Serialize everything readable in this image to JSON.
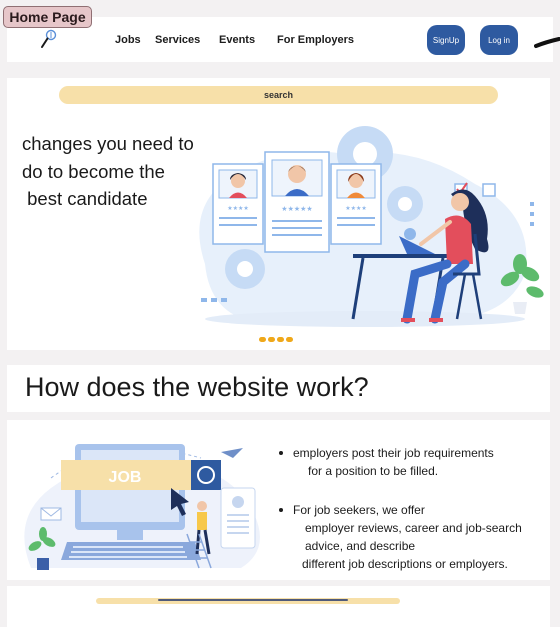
{
  "frame_label": "Home Page",
  "nav": {
    "links": [
      "Jobs",
      "Services",
      "Events",
      "For Employers"
    ],
    "signup_label": "SignUp",
    "login_label": "Log in"
  },
  "search": {
    "label": "search"
  },
  "hero": {
    "lines": [
      "changes you need to",
      "do to become the",
      " best candidate"
    ],
    "illustration_icon": "job-candidates-illustration",
    "carousel_dots": 4
  },
  "section": {
    "title": "How does the website work?"
  },
  "how": {
    "illustration_label": "JOB",
    "bullet1": {
      "line1": "employers post their job requirements",
      "line2": "for a position to be filled."
    },
    "bullet2": {
      "line1": "For job seekers, we offer",
      "line2": "employer reviews, career and job-search",
      "line3": "advice, and describe",
      "line4": "different job descriptions or employers."
    }
  },
  "colors": {
    "primary_button": "#2e5aa0",
    "search_bg": "#f7e0a9",
    "dot": "#efa81a",
    "frame_label_bg": "#e6c6c9"
  }
}
